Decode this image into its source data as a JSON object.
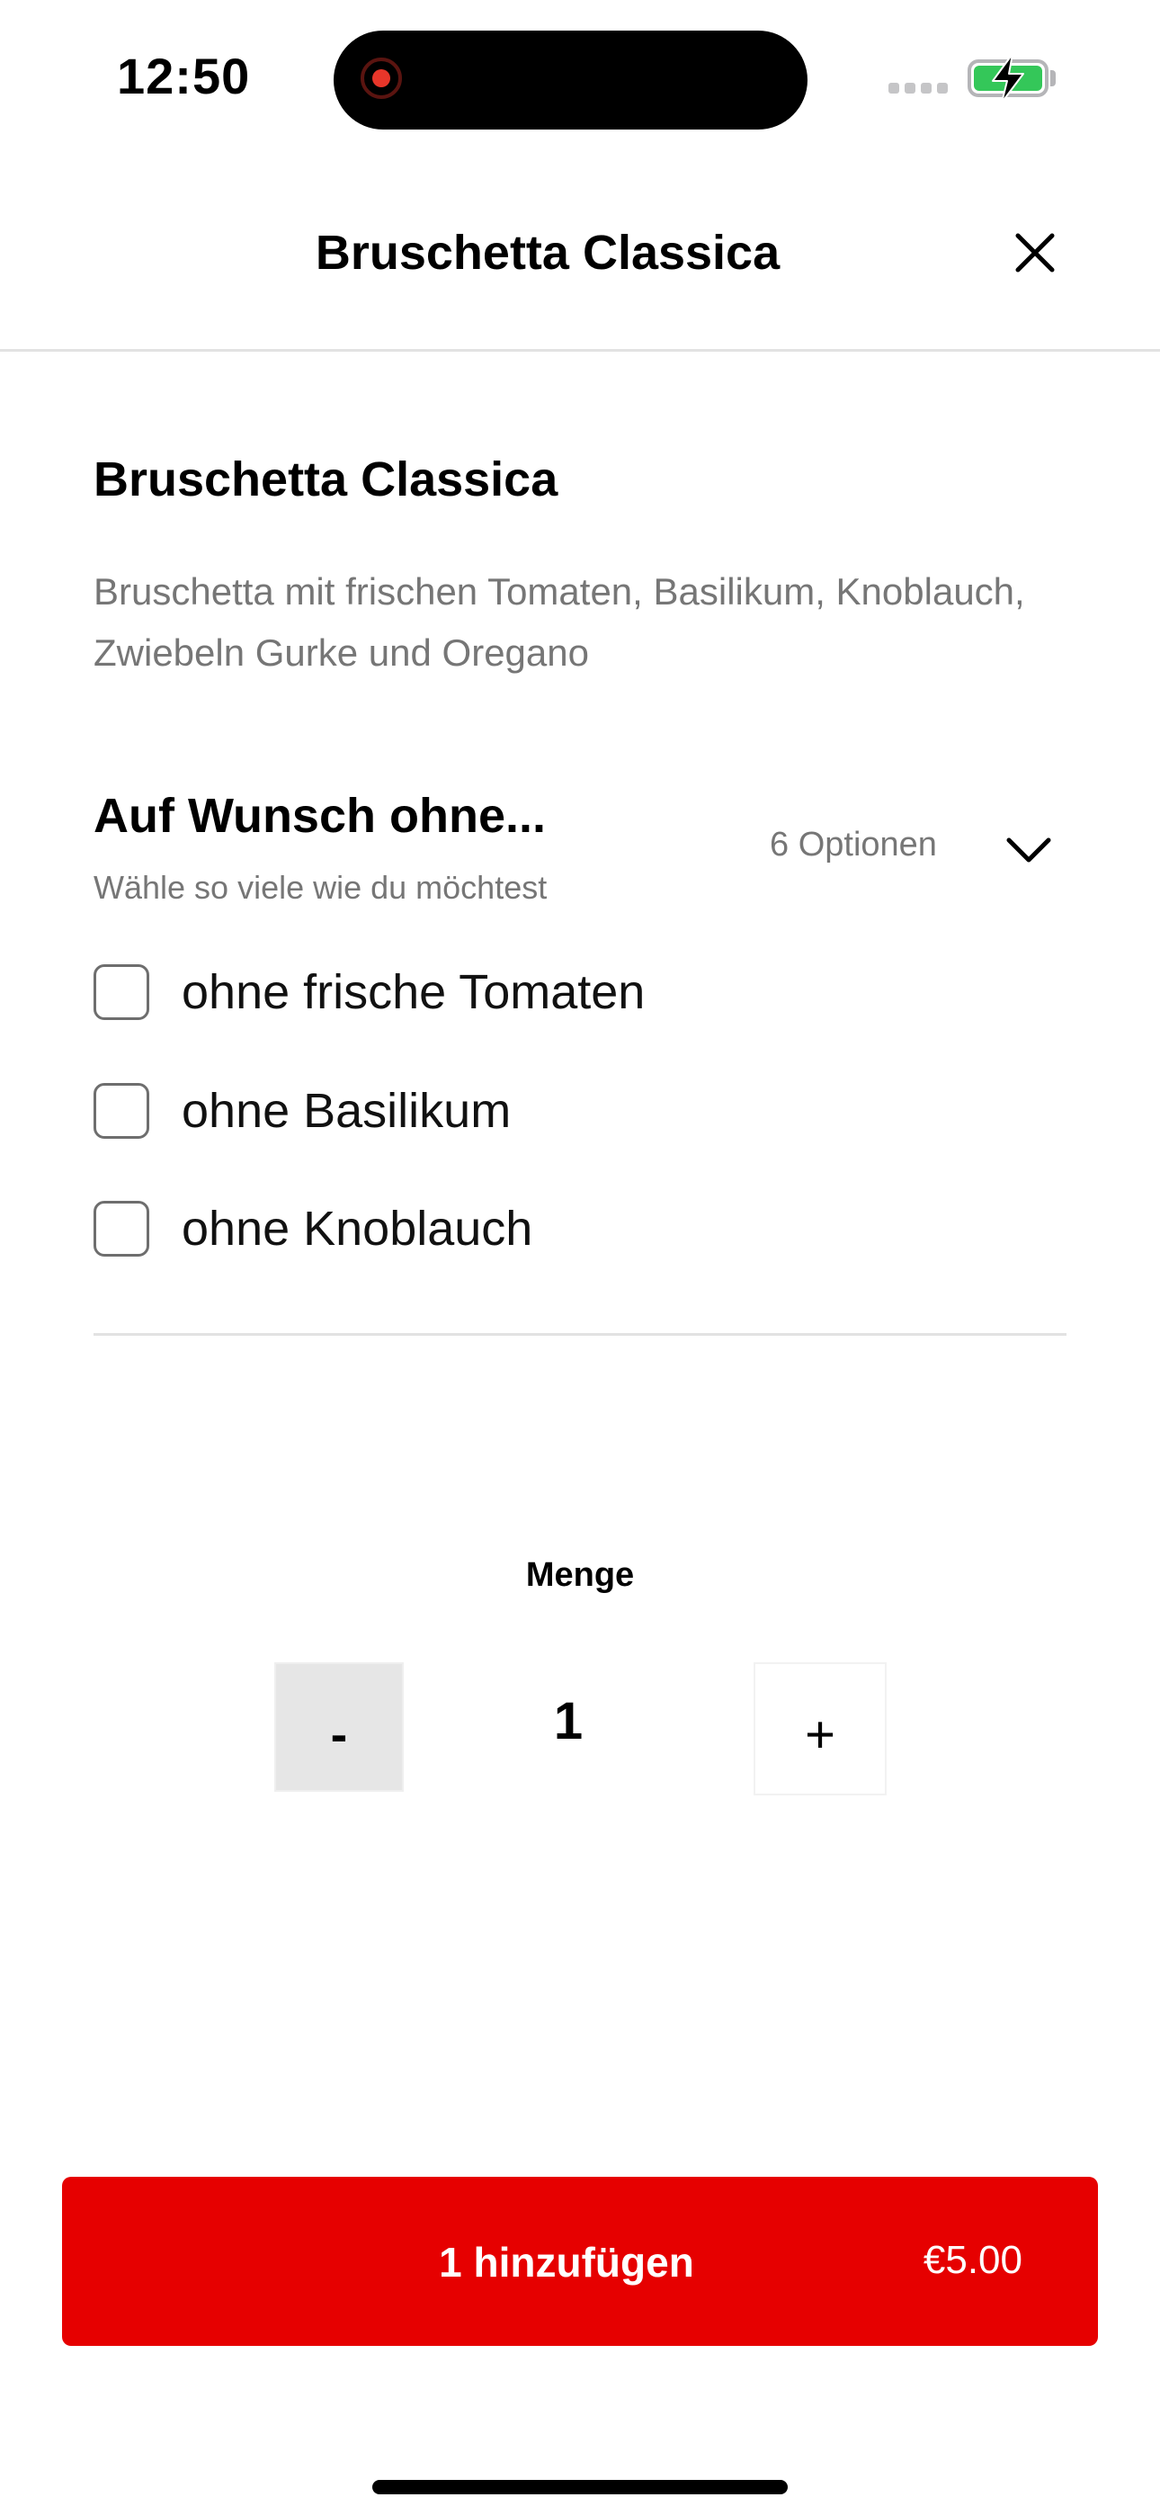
{
  "status_bar": {
    "time": "12:50"
  },
  "header": {
    "title": "Bruschetta Classica"
  },
  "product": {
    "title": "Bruschetta Classica",
    "description": "Bruschetta mit frischen Tomaten, Basilikum, Knoblauch, Zwiebeln Gurke und Oregano"
  },
  "options": {
    "title": "Auf Wunsch ohne...",
    "subtitle": "Wähle so viele wie du möchtest",
    "count": "6 Optionen",
    "items": [
      {
        "label": "ohne frische Tomaten",
        "checked": false
      },
      {
        "label": "ohne Basilikum",
        "checked": false
      },
      {
        "label": "ohne Knoblauch",
        "checked": false
      }
    ]
  },
  "quantity": {
    "label": "Menge",
    "minus_label": "-",
    "value": "1",
    "plus_label": "+"
  },
  "add_button": {
    "label": "1 hinzufügen",
    "price": "€5.00"
  },
  "colors": {
    "accent": "#e60000",
    "battery": "#34c759",
    "muted_text": "#767676",
    "recording": "#e8362a"
  },
  "icons": {
    "close": "close-icon",
    "chevron": "chevron-down-icon",
    "battery": "battery-charging-icon",
    "recording": "recording-indicator-icon"
  }
}
